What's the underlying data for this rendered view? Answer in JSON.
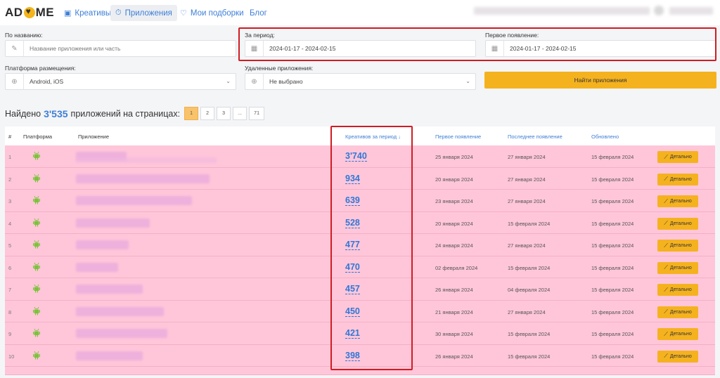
{
  "header": {
    "logo_text": [
      "AD",
      "ME"
    ],
    "nav": [
      {
        "icon": "▣",
        "label": "Креативы"
      },
      {
        "icon": "⏱",
        "label": "Приложения"
      },
      {
        "icon": "♡",
        "label": "Мои подборки"
      },
      {
        "icon": "",
        "label": "Блог"
      }
    ]
  },
  "filters": {
    "name_label": "По названию:",
    "name_placeholder": "Название приложения или часть",
    "period_label": "За период:",
    "period_value": "2024-01-17 - 2024-02-15",
    "first_label": "Первое появление:",
    "first_value": "2024-01-17 - 2024-02-15",
    "platform_label": "Платформа размещения:",
    "platform_value": "Android, iOS",
    "deleted_label": "Удаленные приложения:",
    "deleted_value": "Не выбрано",
    "find_button": "Найти приложения"
  },
  "results": {
    "prefix": "Найдено",
    "count": "3'535",
    "suffix": "приложений на страницах:",
    "pages": [
      "1",
      "2",
      "3",
      "...",
      "71"
    ]
  },
  "table": {
    "headers": {
      "num": "#",
      "platform": "Платформа",
      "app": "Приложение",
      "creatives": "Креативов за период ↓",
      "first": "Первое появление",
      "last": "Последнее появление",
      "updated": "Обновлено"
    },
    "detail_label": "Детально",
    "rows": [
      {
        "n": "1",
        "creatives": "3'740",
        "first": "25 января 2024",
        "last": "27 января 2024",
        "updated": "15 февраля 2024"
      },
      {
        "n": "2",
        "creatives": "934",
        "first": "20 января 2024",
        "last": "27 января 2024",
        "updated": "15 февраля 2024"
      },
      {
        "n": "3",
        "creatives": "639",
        "first": "23 января 2024",
        "last": "27 января 2024",
        "updated": "15 февраля 2024"
      },
      {
        "n": "4",
        "creatives": "528",
        "first": "20 января 2024",
        "last": "15 февраля 2024",
        "updated": "15 февраля 2024"
      },
      {
        "n": "5",
        "creatives": "477",
        "first": "24 января 2024",
        "last": "27 января 2024",
        "updated": "15 февраля 2024"
      },
      {
        "n": "6",
        "creatives": "470",
        "first": "02 февраля 2024",
        "last": "15 февраля 2024",
        "updated": "15 февраля 2024"
      },
      {
        "n": "7",
        "creatives": "457",
        "first": "26 января 2024",
        "last": "04 февраля 2024",
        "updated": "15 февраля 2024"
      },
      {
        "n": "8",
        "creatives": "450",
        "first": "21 января 2024",
        "last": "27 января 2024",
        "updated": "15 февраля 2024"
      },
      {
        "n": "9",
        "creatives": "421",
        "first": "30 января 2024",
        "last": "15 февраля 2024",
        "updated": "15 февраля 2024"
      },
      {
        "n": "10",
        "creatives": "398",
        "first": "26 января 2024",
        "last": "15 февраля 2024",
        "updated": "15 февраля 2024"
      }
    ]
  },
  "colors": {
    "accent": "#3d7fd6",
    "button": "#f5b21f",
    "row_highlight": "#ffc6d9",
    "annotation_red": "#d01c24",
    "android_green": "#7cc33c"
  }
}
